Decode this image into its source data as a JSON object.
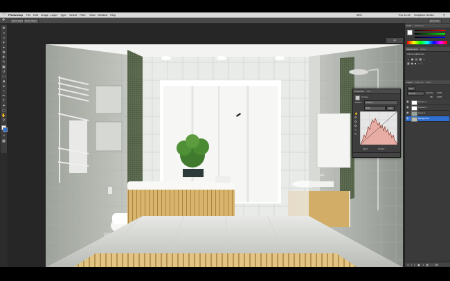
{
  "menubar": {
    "app_name": "Photoshop",
    "items": [
      "File",
      "Edit",
      "Image",
      "Layer",
      "Type",
      "Select",
      "Filter",
      "View",
      "Window",
      "Help"
    ],
    "status": {
      "battery": "98%",
      "clock": "Thu 11:45",
      "user": "Graphics Geeks"
    }
  },
  "options_bar": {
    "buttons": [
      "Select Mask",
      "Refine Mask"
    ]
  },
  "workspace": {
    "label": "Essentials"
  },
  "properties_panel": {
    "tabs": [
      "Properties",
      "Info"
    ],
    "title": "Curves",
    "preset_label": "Preset:",
    "preset_value": "Custom",
    "channel_value": "RGB",
    "auto_label": "Auto",
    "input_output_labels": [
      "Input:",
      "Output:"
    ]
  },
  "color_panel": {
    "tabs": [
      "Color",
      "Swatches"
    ]
  },
  "adjustments_panel": {
    "tabs": [
      "Adjustments",
      "Styles"
    ],
    "subtitle": "Add an adjustment"
  },
  "layers_panel": {
    "tabs": [
      "Layers",
      "Channels",
      "Paths"
    ],
    "kind_label": "Kind",
    "mode_value": "Normal",
    "opacity_label": "Opacity:",
    "opacity_value": "100%",
    "fill_label": "Fill:",
    "fill_value": "100%",
    "layers": [
      {
        "name": "Curves 1",
        "type": "adjustment"
      },
      {
        "name": "Curves 2",
        "type": "adjustment"
      },
      {
        "name": "Layer 1",
        "type": "pixel"
      },
      {
        "name": "Background",
        "type": "pixel",
        "selected": true
      }
    ]
  },
  "colors": {
    "accent": "#2f6fd1",
    "panel_bg": "#3a3a3a",
    "histogram_fill": "#e8a39a",
    "toolbox_bg": "#3c3c3c"
  },
  "icons": {
    "apple": "apple-icon",
    "move_tool": "move-tool-icon",
    "marquee_tool": "marquee-tool-icon",
    "lasso_tool": "lasso-tool-icon",
    "wand_tool": "magic-wand-icon",
    "crop_tool": "crop-icon",
    "eyedropper": "eyedropper-icon",
    "brush": "brush-icon",
    "eraser": "eraser-icon",
    "pen": "pen-icon",
    "text": "text-tool-icon",
    "hand": "hand-icon",
    "zoom": "zoom-icon",
    "eye": "eye-icon"
  }
}
